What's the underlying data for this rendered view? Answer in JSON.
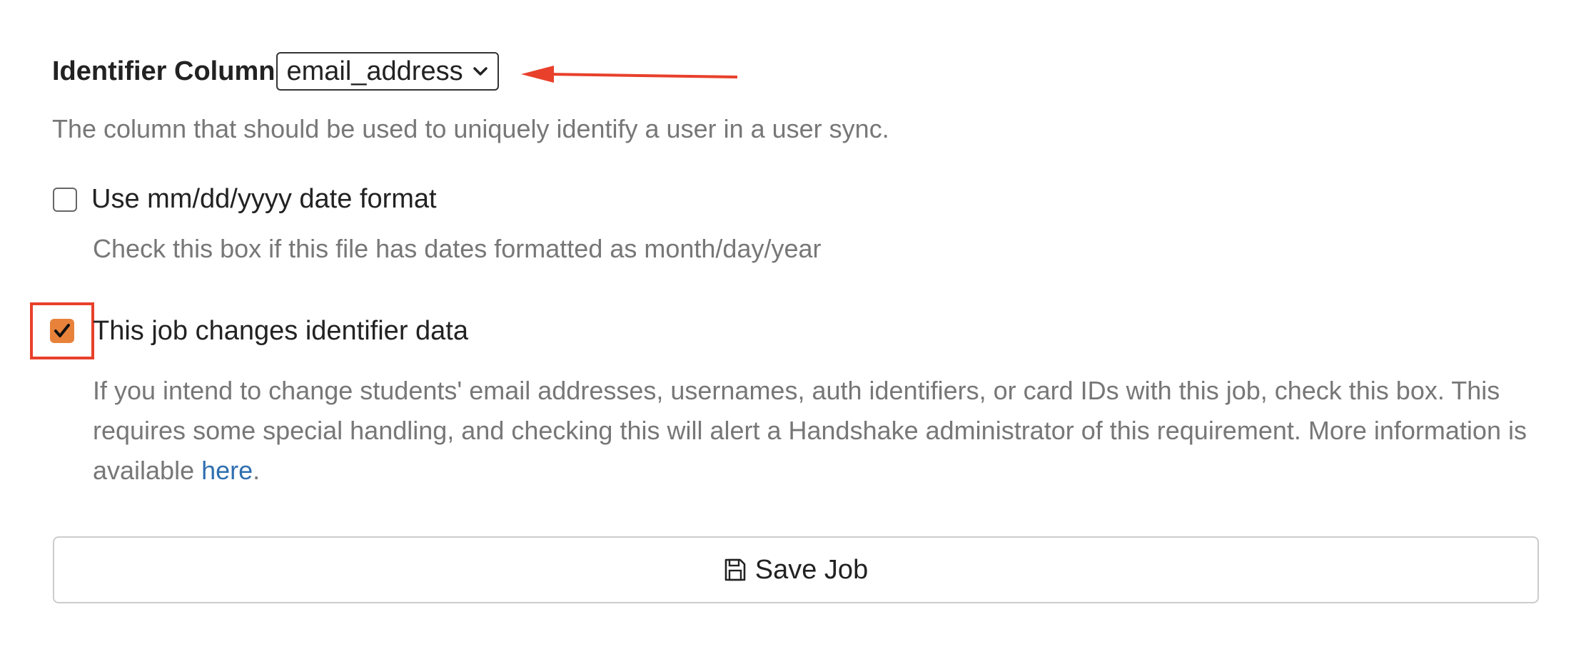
{
  "identifier": {
    "label": "Identifier Column",
    "selected": "email_address",
    "help": "The column that should be used to uniquely identify a user in a user sync."
  },
  "date_format": {
    "label": "Use mm/dd/yyyy date format",
    "checked": false,
    "help": "Check this box if this file has dates formatted as month/day/year"
  },
  "identifier_change": {
    "label": "This job changes identifier data",
    "checked": true,
    "help_text": "If you intend to change students' email addresses, usernames, auth identifiers, or card IDs with this job, check this box. This requires some special handling, and checking this will alert a Handshake administrator of this requirement. More information is available ",
    "link_text": "here",
    "help_suffix": "."
  },
  "save_button": {
    "label": "Save Job",
    "icon": "save-icon"
  },
  "colors": {
    "annotation_red": "#e8402b",
    "checkbox_checked": "#e8823a",
    "link": "#2f6fb0",
    "help_text": "#777777"
  }
}
